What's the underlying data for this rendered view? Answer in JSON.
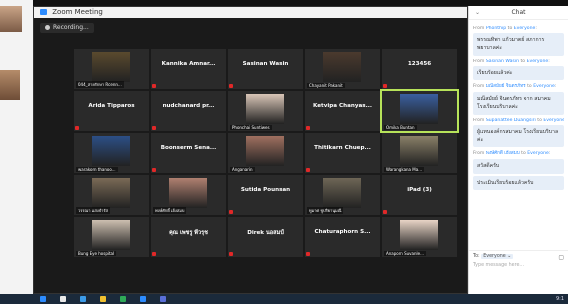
{
  "window": {
    "title": "Zoom Meeting"
  },
  "recording": {
    "label": "Recording..."
  },
  "gallery": {
    "tiles": [
      {
        "name": "044_สายรักษา Rcenn...",
        "kind": "video",
        "color": "#5a4a2e"
      },
      {
        "name": "Kannika Amnar...",
        "kind": "name"
      },
      {
        "name": "Sasinan Wasin",
        "kind": "name"
      },
      {
        "name": "Chayanit Pakanit",
        "kind": "video",
        "color": "#4b3a2e"
      },
      {
        "name": "123456",
        "kind": "name"
      },
      {
        "name": "Arida Tipparos",
        "kind": "name"
      },
      {
        "name": "nudchanard pr...",
        "kind": "name"
      },
      {
        "name": "Phonchai Suntiwes",
        "kind": "video",
        "color": "#d9c6b8"
      },
      {
        "name": "Ketvipa Chanyas...",
        "kind": "name"
      },
      {
        "name": "Omika Buntan",
        "kind": "video",
        "color": "#3a5fa0",
        "active": true
      },
      {
        "name": "warakorn thanoo...",
        "kind": "video",
        "color": "#2c4f86"
      },
      {
        "name": "Boonserm Sena...",
        "kind": "name"
      },
      {
        "name": "Anganarin",
        "kind": "video",
        "color": "#a07060"
      },
      {
        "name": "Thitikarn Chuep...",
        "kind": "name"
      },
      {
        "name": "Warangkana Ma...",
        "kind": "video",
        "color": "#8a8068"
      },
      {
        "name": "วรรณา แสงจำรัส",
        "kind": "video",
        "color": "#7a6a56"
      },
      {
        "name": "พงษ์ศักดิ์ เฮ้งสมบ",
        "kind": "video",
        "color": "#b08070"
      },
      {
        "name": "Sutida Pounsan",
        "kind": "name"
      },
      {
        "name": "ทูมาศ ชูปริยานุมณี",
        "kind": "video",
        "color": "#6e6656"
      },
      {
        "name": "iPad (3)",
        "kind": "name"
      },
      {
        "name": "Bung Eye hospital",
        "kind": "video",
        "color": "#cdbfb0"
      },
      {
        "name": "คุณ เพชรู พี่วรุช",
        "kind": "name"
      },
      {
        "name": "Direk นอสมป์",
        "kind": "name"
      },
      {
        "name": "Chaturaphorn S...",
        "kind": "name"
      },
      {
        "name": "Anaporn Suvanle...",
        "kind": "video",
        "color": "#e8d4c6"
      }
    ]
  },
  "chat": {
    "title": "Chat",
    "collapse_label": "⌄",
    "messages": [
      {
        "from": "Phonthip",
        "to": "Everyone",
        "text": "พรรณทิพา แก้วมาตย์ สภาการพยาบาลค่ะ"
      },
      {
        "from": "Sasinan Wasin",
        "to": "Everyone",
        "text": "เรียบร้อยแล้วค่ะ"
      },
      {
        "from": "มณีสมัยย์ จินตรภัทร",
        "to": "Everyone",
        "text": "มณีสมัยย์ จินตรภัทร จาก สมาคมโรงเรียนบริบาลค่ะ"
      },
      {
        "from": "Supanattee Duangsiri",
        "to": "Everyone",
        "text": "ผู้แทนองค์กรสมาคม โรงเรียนบริบาลค่ะ"
      },
      {
        "from": "พงษ์ศักดิ์ เฮ้งสมบ",
        "to": "Everyone",
        "text": "สวัสดีครับ"
      },
      {
        "from": "",
        "to": "",
        "text": "ประเมินเรียบร้อยแล้วครับ"
      }
    ],
    "from_word": "From",
    "to_word": "to",
    "input": {
      "to_label": "To:",
      "recipient": "Everyone ⌄",
      "placeholder": "Type message here..."
    }
  },
  "taskbar": {
    "clock": "9:1"
  },
  "colors": {
    "active_speaker": "#b7e35a",
    "mic_muted": "#e02828",
    "zoom_blue": "#2d8cff"
  }
}
